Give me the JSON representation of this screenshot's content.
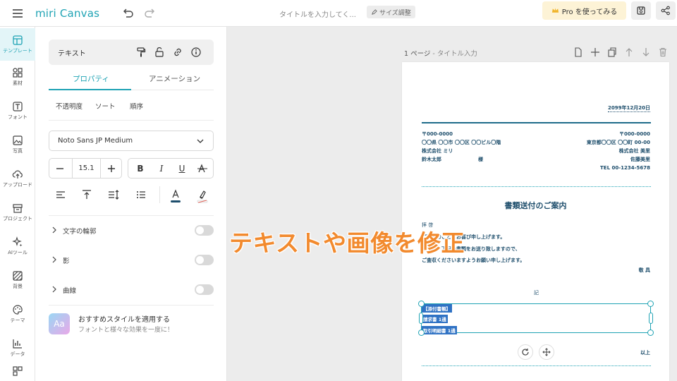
{
  "app": {
    "logo": "miri Canvas",
    "doc_title": "タイトルを入力してく...",
    "resize_label": "サイズ調整",
    "pro_label": "Pro を使ってみる"
  },
  "rail": {
    "items": [
      {
        "label": "テンプレート",
        "icon": "template-icon"
      },
      {
        "label": "素材",
        "icon": "shapes-icon"
      },
      {
        "label": "フォント",
        "icon": "text-icon"
      },
      {
        "label": "写真",
        "icon": "image-icon"
      },
      {
        "label": "アップロード",
        "icon": "upload-icon"
      },
      {
        "label": "プロジェクト",
        "icon": "project-icon"
      },
      {
        "label": "AIツール",
        "icon": "sparkle-icon"
      },
      {
        "label": "背景",
        "icon": "background-icon"
      },
      {
        "label": "テーマ",
        "icon": "palette-icon"
      },
      {
        "label": "データ",
        "icon": "chart-icon"
      }
    ]
  },
  "panel": {
    "header": "テキスト",
    "tabs": [
      "プロパティ",
      "アニメーション"
    ],
    "subs": [
      "不透明度",
      "ソート",
      "順序"
    ],
    "font": "Noto Sans JP Medium",
    "font_size": "15.1",
    "toggles": [
      "文字の輪郭",
      "影",
      "曲線"
    ],
    "recommend_title": "おすすめスタイルを適用する",
    "recommend_sub": "フォントと様々な効果を一度に！",
    "recommend_icon": "Aa"
  },
  "canvas": {
    "page_label": "1 ページ",
    "page_title": "タイトル入力",
    "letter": {
      "date": "2099年12月20日",
      "left_zip": "〒000-0000",
      "left_addr": "〇〇県 〇〇市 〇〇区 〇〇ビル〇階",
      "left_company": "株式会社 ミリ",
      "left_name": "鈴木太郎",
      "honorific": "様",
      "right_zip": "〒000-0000",
      "right_addr": "東京都〇〇区 〇〇町 00-00",
      "right_company": "株式会社 美里",
      "right_name": "佐藤美里",
      "right_tel": "TEL 00-1234-5678",
      "title": "書類送付のご案内",
      "greeting": "拝 啓",
      "body1": "ご清栄のこととお喜び申し上げます。",
      "body2": "ますが、下記の書類をお送り致しますので、",
      "body3": "ご査収くださいますようお願い申し上げます。",
      "closing": "敬 具",
      "ki": "記",
      "item1": "【添付書類】",
      "item2": "請求書 1通",
      "item3": "取引明細書 1通",
      "ijou": "以上"
    }
  },
  "caption": "テキストや画像を修正",
  "colors": {
    "accent": "#1fa3b4",
    "caption": "#f28a2e",
    "highlight": "#2f72c4",
    "pro_bg": "#fdf3d6"
  }
}
